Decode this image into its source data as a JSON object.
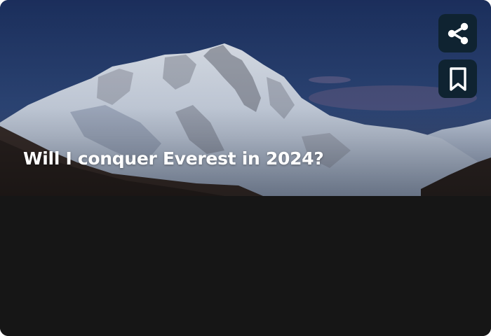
{
  "card": {
    "title": "Will I conquer Everest in 2024?"
  },
  "actions": {
    "share": {
      "icon": "share-icon"
    },
    "bookmark": {
      "icon": "bookmark-icon"
    }
  },
  "colors": {
    "sky_top": "#1f3566",
    "sky_bottom": "#4a5f8e",
    "snow": "#dbe4f0",
    "button_bg": "#0f2331",
    "body_bg": "#161616",
    "title_text": "#ffffff"
  }
}
